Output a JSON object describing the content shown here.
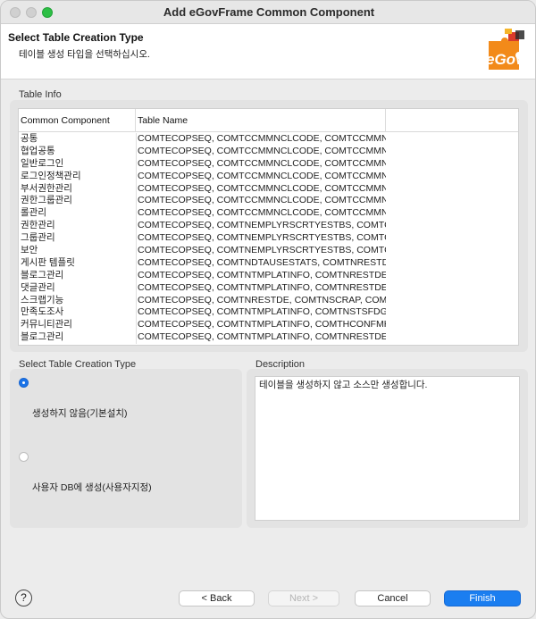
{
  "window": {
    "title": "Add eGovFrame Common Component"
  },
  "header": {
    "title": "Select Table Creation Type",
    "subtitle": "테이블 생성 타입을 선택하십시오.",
    "logo_text": "eGov"
  },
  "table_info": {
    "label": "Table Info",
    "columns": [
      "Common Component",
      "Table Name"
    ],
    "rows": [
      [
        "공통",
        "COMTECOPSEQ, COMTCCMMNCLCODE, COMTCCMMN"
      ],
      [
        "협업공통",
        "COMTECOPSEQ, COMTCCMMNCLCODE, COMTCCMMN"
      ],
      [
        "일반로그인",
        "COMTECOPSEQ, COMTCCMMNCLCODE, COMTCCMMN"
      ],
      [
        "로그인정책관리",
        "COMTECOPSEQ, COMTCCMMNCLCODE, COMTCCMMN"
      ],
      [
        "부서권한관리",
        "COMTECOPSEQ, COMTCCMMNCLCODE, COMTCCMMN"
      ],
      [
        "권한그룹관리",
        "COMTECOPSEQ, COMTCCMMNCLCODE, COMTCCMMN"
      ],
      [
        "롤관리",
        "COMTECOPSEQ, COMTCCMMNCLCODE, COMTCCMMN"
      ],
      [
        "권한관리",
        "COMTECOPSEQ, COMTNEMPLYRSCRTYESTBS, COMTC"
      ],
      [
        "그룹관리",
        "COMTECOPSEQ, COMTNEMPLYRSCRTYESTBS, COMTC"
      ],
      [
        "보안",
        "COMTECOPSEQ, COMTNEMPLYRSCRTYESTBS, COMTC"
      ],
      [
        "게시판 템플릿",
        "COMTECOPSEQ, COMTNDTAUSESTATS, COMTNRESTDE"
      ],
      [
        "블로그관리",
        "COMTECOPSEQ, COMTNTMPLATINFO, COMTNRESTDE,"
      ],
      [
        "댓글관리",
        "COMTECOPSEQ, COMTNTMPLATINFO, COMTNRESTDE,"
      ],
      [
        "스크랩기능",
        "COMTECOPSEQ, COMTNRESTDE, COMTNSCRAP, COMT"
      ],
      [
        "만족도조사",
        "COMTECOPSEQ, COMTNTMPLATINFO, COMTNSTSFDG,"
      ],
      [
        "커뮤니티관리",
        "COMTECOPSEQ, COMTNTMPLATINFO, COMTHCONFMH"
      ],
      [
        "블로그관리",
        "COMTECOPSEQ, COMTNTMPLATINFO, COMTNRESTDE,"
      ]
    ]
  },
  "creation_type": {
    "label": "Select Table Creation Type",
    "options": [
      {
        "label": "생성하지 않음(기본설치)",
        "selected": true
      },
      {
        "label": "사용자 DB에 생성(사용자지정)",
        "selected": false
      }
    ]
  },
  "description": {
    "label": "Description",
    "text": "테이블을 생성하지 않고 소스만 생성합니다."
  },
  "footer": {
    "help": "?",
    "back": "< Back",
    "next": "Next >",
    "cancel": "Cancel",
    "finish": "Finish"
  },
  "colors": {
    "accent": "#1b7ef0",
    "logo_orange": "#f28a1a",
    "logo_red": "#d93a2b"
  }
}
